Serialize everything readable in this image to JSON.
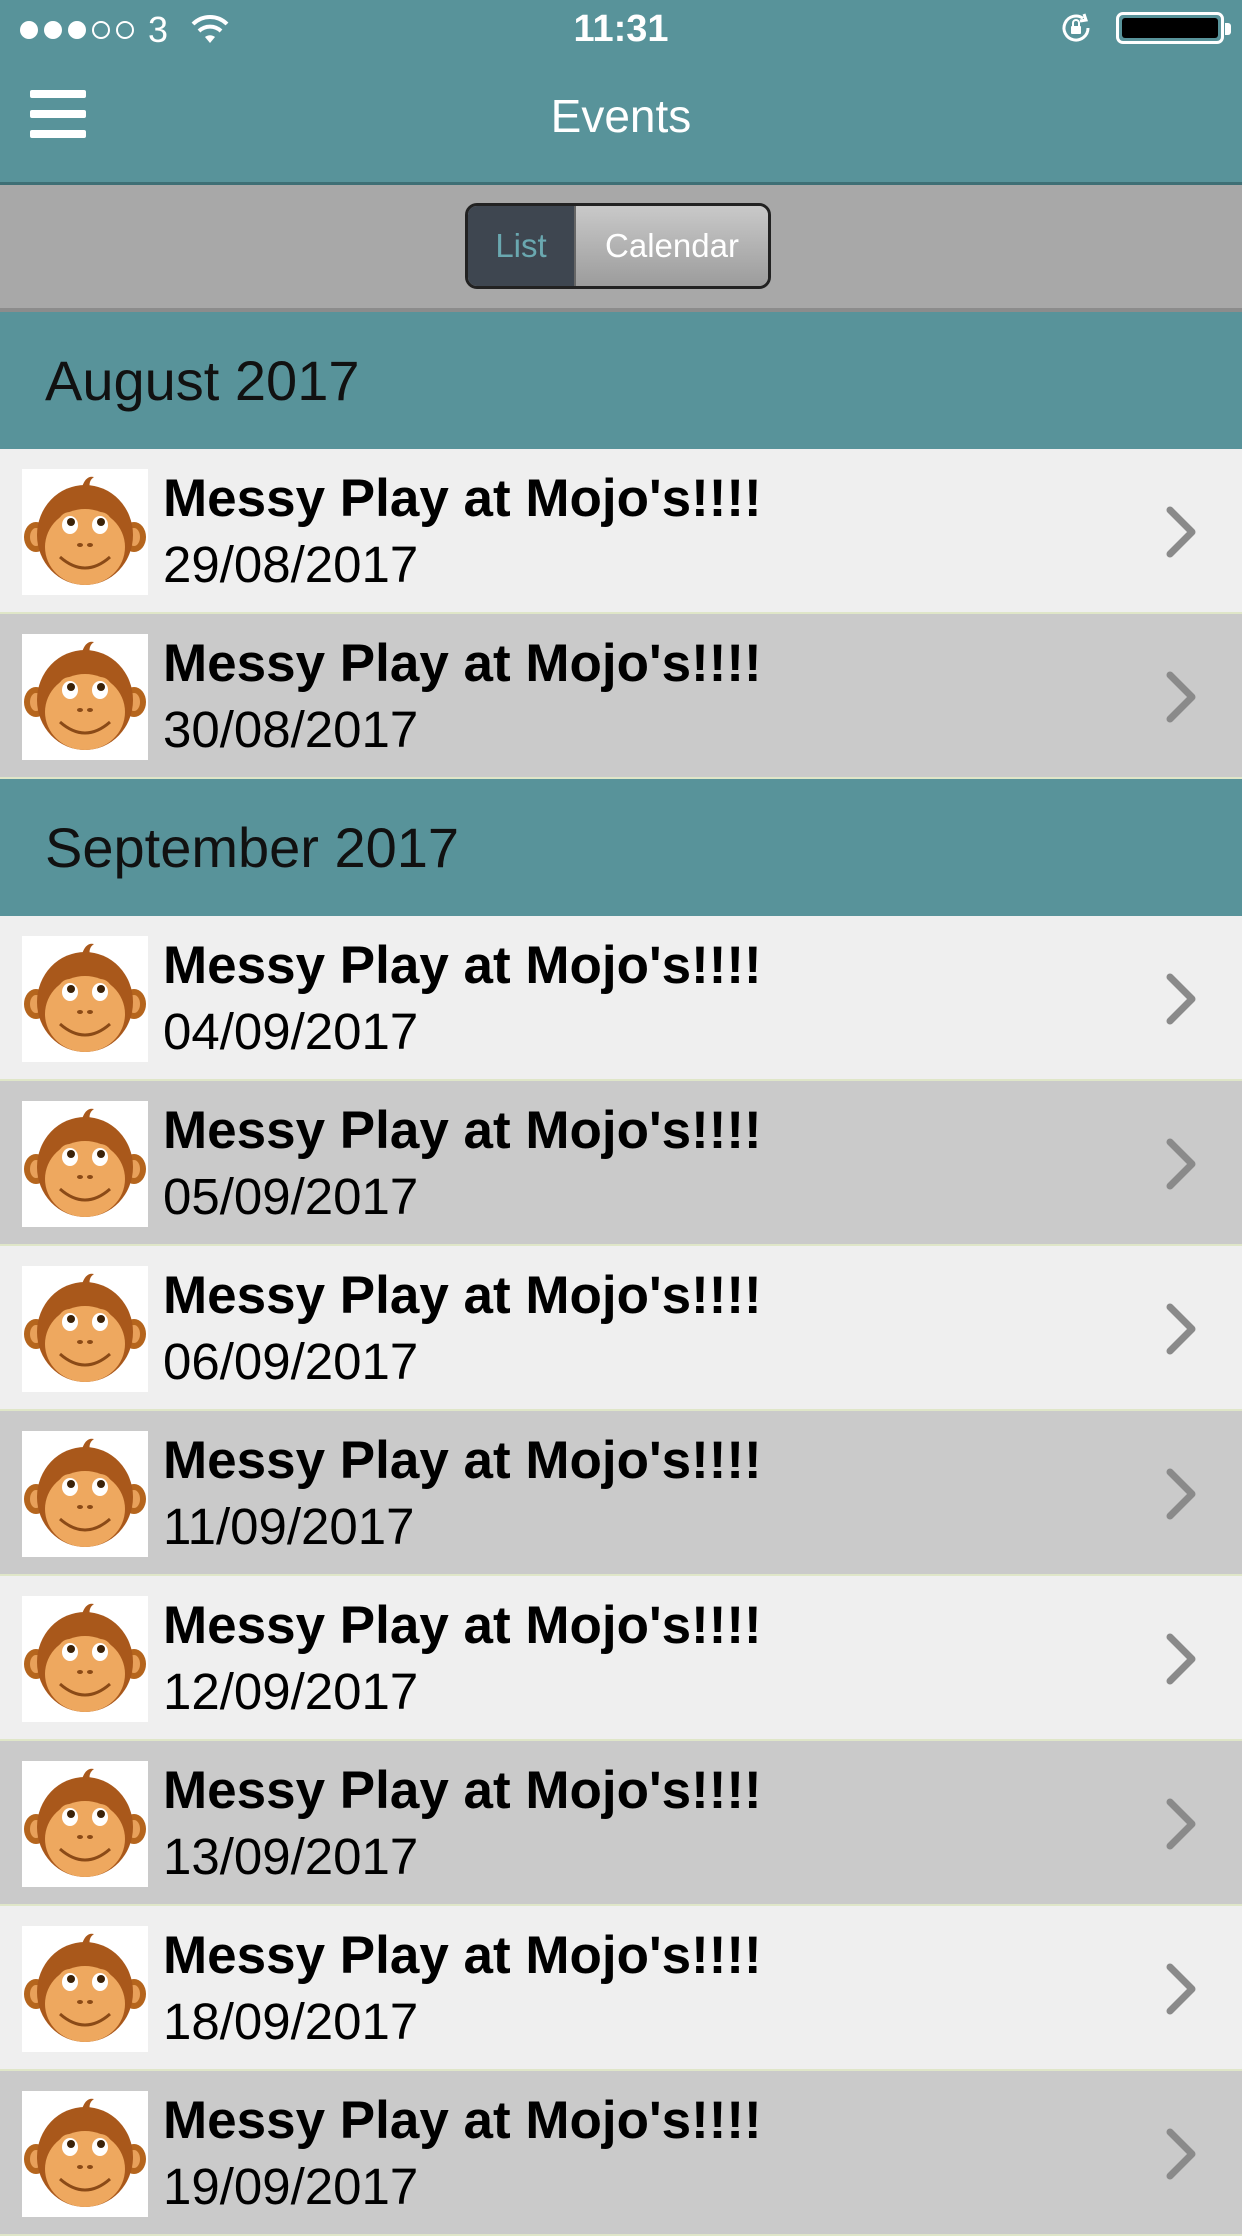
{
  "status_bar": {
    "carrier": "3",
    "time": "11:31",
    "signal_bars_filled": 3,
    "signal_bars_total": 5,
    "icons": [
      "wifi-icon",
      "rotation-lock-icon",
      "battery-icon"
    ]
  },
  "nav": {
    "title": "Events",
    "menu_icon": "hamburger-menu-icon"
  },
  "segmented": {
    "options": [
      "List",
      "Calendar"
    ],
    "selected": "List"
  },
  "sections": [
    {
      "header": "August 2017",
      "items": [
        {
          "title": "Messy Play at Mojo's!!!!",
          "date": "29/08/2017"
        },
        {
          "title": "Messy Play at Mojo's!!!!",
          "date": "30/08/2017"
        }
      ]
    },
    {
      "header": "September 2017",
      "items": [
        {
          "title": "Messy Play at Mojo's!!!!",
          "date": "04/09/2017"
        },
        {
          "title": "Messy Play at Mojo's!!!!",
          "date": "05/09/2017"
        },
        {
          "title": "Messy Play at Mojo's!!!!",
          "date": "06/09/2017"
        },
        {
          "title": "Messy Play at Mojo's!!!!",
          "date": "11/09/2017"
        },
        {
          "title": "Messy Play at Mojo's!!!!",
          "date": "12/09/2017"
        },
        {
          "title": "Messy Play at Mojo's!!!!",
          "date": "13/09/2017"
        },
        {
          "title": "Messy Play at Mojo's!!!!",
          "date": "18/09/2017"
        },
        {
          "title": "Messy Play at Mojo's!!!!",
          "date": "19/09/2017"
        }
      ]
    }
  ],
  "colors": {
    "header_teal": "#58939a",
    "row_light": "#efefef",
    "row_dark": "#cacaca",
    "segment_selected_text": "#6aa8b0"
  }
}
